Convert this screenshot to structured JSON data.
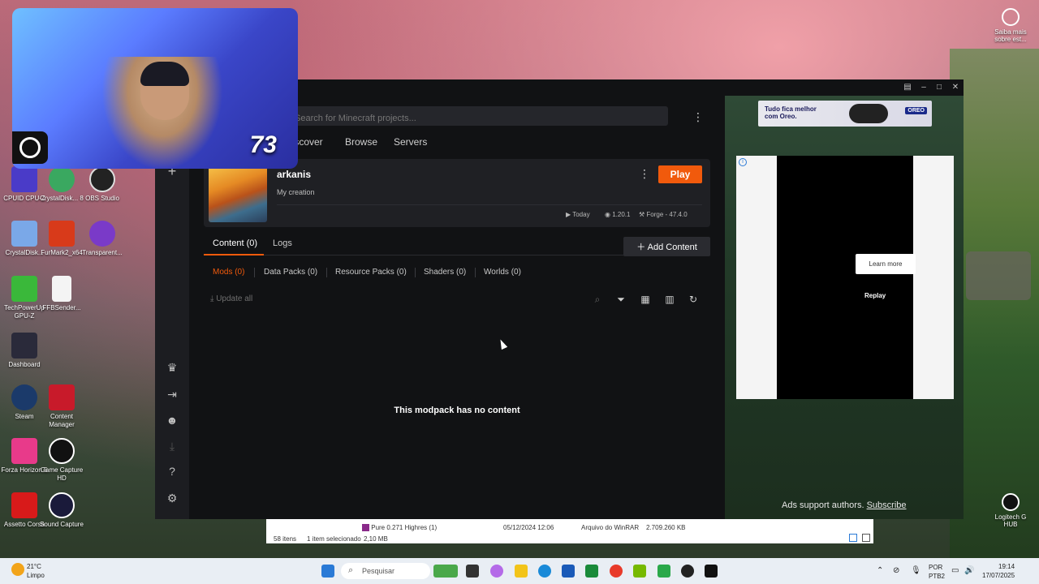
{
  "desktop": {
    "icons": [
      {
        "label": "CPUID CPU-Z"
      },
      {
        "label": "CrystalDisk... 8"
      },
      {
        "label": "OBS Studio"
      },
      {
        "label": "CrystalDisk..."
      },
      {
        "label": "FurMark2_x64"
      },
      {
        "label": "Transparent..."
      },
      {
        "label": "TechPowerUp GPU-Z"
      },
      {
        "label": "FFBSender..."
      },
      {
        "label": "Dashboard"
      },
      {
        "label": "Steam"
      },
      {
        "label": "Content Manager"
      },
      {
        "label": "Forza Horizon 5"
      },
      {
        "label": "Game Capture HD"
      },
      {
        "label": "Assetto Corsa"
      },
      {
        "label": "Sound Capture"
      }
    ],
    "corner_top": "Saiba mais sobre est...",
    "corner_bottom": "Logitech G HUB"
  },
  "webcam": {
    "number": "73"
  },
  "app": {
    "search_placeholder": "Search for Minecraft projects...",
    "nav": {
      "discover": "Discover",
      "browse": "Browse",
      "servers": "Servers"
    },
    "instance": {
      "name": "arkanis",
      "subtitle": "My creation",
      "play_label": "Play",
      "last_played": "Today",
      "game_version": "1.20.1",
      "loader": "Forge - 47.4.0"
    },
    "tabs": {
      "content": "Content (0)",
      "logs": "Logs"
    },
    "add_content_label": "Add Content",
    "subtabs": {
      "mods": "Mods (0)",
      "data_packs": "Data Packs (0)",
      "resource_packs": "Resource Packs (0)",
      "shaders": "Shaders (0)",
      "worlds": "Worlds (0)"
    },
    "update_all": "Update all",
    "empty_message": "This modpack has no content"
  },
  "ads": {
    "banner_text": "Tudo fica melhor com Oreo.",
    "banner_brand": "OREO",
    "learn_more": "Learn more",
    "replay": "Replay",
    "note": "Ads support authors.",
    "subscribe": "Subscribe"
  },
  "explorer": {
    "file_name": "Pure 0.271 Highres (1)",
    "file_date": "05/12/2024 12:06",
    "file_type": "Arquivo do WinRAR",
    "file_size": "2.709.260 KB",
    "items_count": "58 itens",
    "selected": "1 item selecionado",
    "selected_size": "2,10 MB"
  },
  "taskbar": {
    "weather_temp": "21°C",
    "weather_desc": "Limpo",
    "search": "Pesquisar",
    "lang1": "POR",
    "lang2": "PTB2",
    "time": "19:14",
    "date": "17/07/2025"
  },
  "colors": {
    "accent": "#f15a0c",
    "app_bg": "#111214"
  }
}
